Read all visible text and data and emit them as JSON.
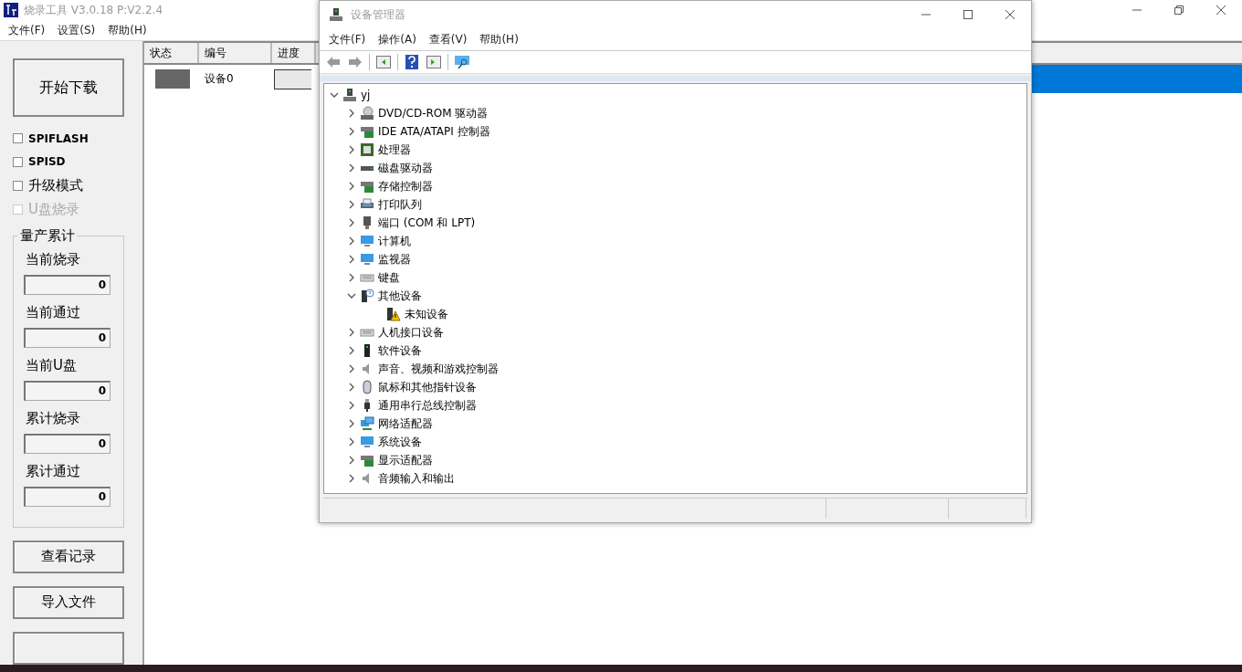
{
  "app": {
    "title": "烧录工具 V3.0.18 P:V2.2.4",
    "menu": [
      "文件(F)",
      "设置(S)",
      "帮助(H)"
    ],
    "start_button": "开始下载",
    "options": [
      {
        "label": "SPIFLASH",
        "checked": false,
        "disabled": false
      },
      {
        "label": "SPISD",
        "checked": false,
        "disabled": false
      },
      {
        "label": "升级模式",
        "checked": false,
        "disabled": false
      },
      {
        "label": "U盘烧录",
        "checked": false,
        "disabled": true
      }
    ],
    "counter_group": {
      "title": "量产累计",
      "counters": [
        {
          "label": "当前烧录",
          "value": "0"
        },
        {
          "label": "当前通过",
          "value": "0"
        },
        {
          "label": "当前U盘",
          "value": "0"
        },
        {
          "label": "累计烧录",
          "value": "0"
        },
        {
          "label": "累计通过",
          "value": "0"
        }
      ]
    },
    "buttons": [
      "查看记录",
      "导入文件"
    ],
    "table": {
      "columns": [
        "状态",
        "编号",
        "进度"
      ],
      "rows": [
        {
          "color": "#666666",
          "id": "设备0",
          "level": 0,
          "selected": true
        }
      ]
    }
  },
  "device_manager": {
    "title": "设备管理器",
    "menu": [
      "文件(F)",
      "操作(A)",
      "查看(V)",
      "帮助(H)"
    ],
    "tree": {
      "label": "yj",
      "kind": "computer",
      "expanded": true,
      "children": [
        {
          "label": "DVD/CD-ROM 驱动器",
          "kind": "disc",
          "expanded": false
        },
        {
          "label": "IDE ATA/ATAPI 控制器",
          "kind": "controller",
          "expanded": false
        },
        {
          "label": "处理器",
          "kind": "chip",
          "expanded": false
        },
        {
          "label": "磁盘驱动器",
          "kind": "drive",
          "expanded": false
        },
        {
          "label": "存储控制器",
          "kind": "controller",
          "expanded": false
        },
        {
          "label": "打印队列",
          "kind": "printer",
          "expanded": false
        },
        {
          "label": "端口 (COM 和 LPT)",
          "kind": "port",
          "expanded": false
        },
        {
          "label": "计算机",
          "kind": "monitor",
          "expanded": false
        },
        {
          "label": "监视器",
          "kind": "monitor",
          "expanded": false
        },
        {
          "label": "键盘",
          "kind": "keyboard",
          "expanded": false
        },
        {
          "label": "其他设备",
          "kind": "unknown",
          "expanded": true,
          "children": [
            {
              "label": "未知设备",
              "kind": "warning"
            }
          ]
        },
        {
          "label": "人机接口设备",
          "kind": "keyboard",
          "expanded": false
        },
        {
          "label": "软件设备",
          "kind": "tower",
          "expanded": false
        },
        {
          "label": "声音、视频和游戏控制器",
          "kind": "speaker",
          "expanded": false
        },
        {
          "label": "鼠标和其他指针设备",
          "kind": "mouse",
          "expanded": false
        },
        {
          "label": "通用串行总线控制器",
          "kind": "usb",
          "expanded": false
        },
        {
          "label": "网络适配器",
          "kind": "network",
          "expanded": false
        },
        {
          "label": "系统设备",
          "kind": "monitor",
          "expanded": false
        },
        {
          "label": "显示适配器",
          "kind": "controller",
          "expanded": false
        },
        {
          "label": "音频输入和输出",
          "kind": "speaker",
          "expanded": false
        }
      ]
    }
  }
}
